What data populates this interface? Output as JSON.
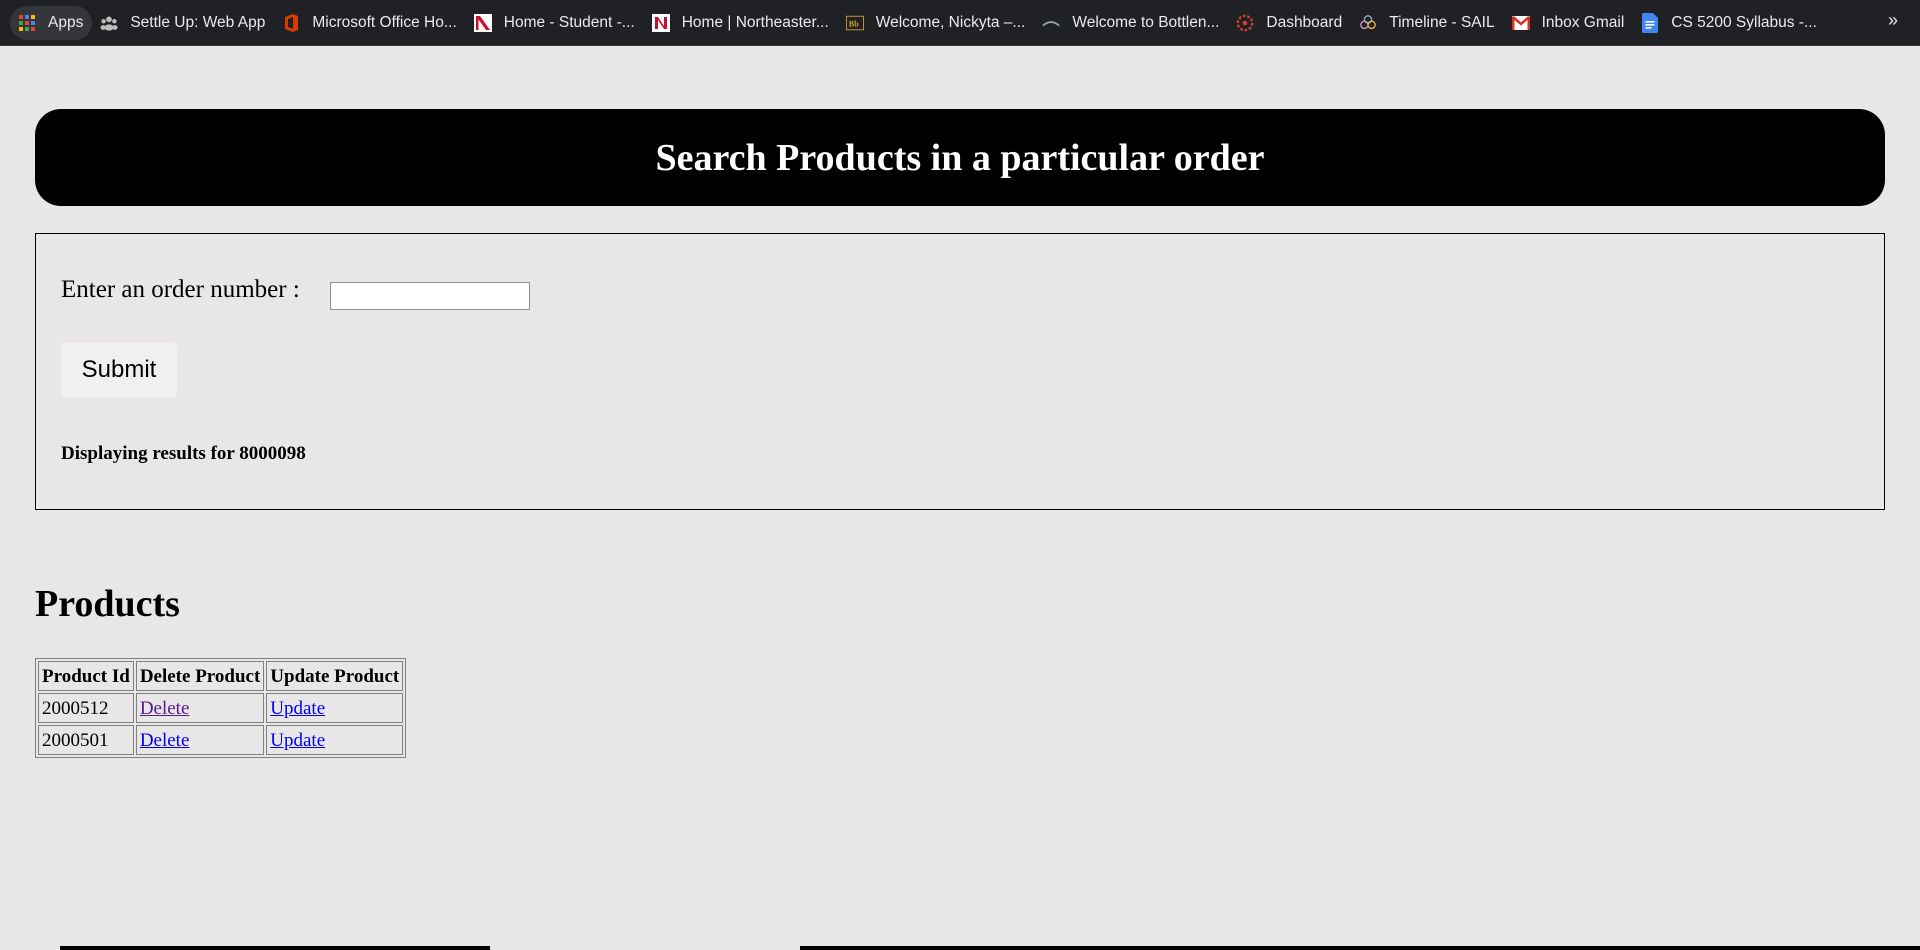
{
  "bookmarks": {
    "apps_label": "Apps",
    "items": [
      {
        "label": "Settle Up: Web App",
        "icon": "people-icon"
      },
      {
        "label": "Microsoft Office Ho...",
        "icon": "office-icon"
      },
      {
        "label": "Home - Student -...",
        "icon": "northeastern-icon"
      },
      {
        "label": "Home | Northeaster...",
        "icon": "northeastern-n-icon"
      },
      {
        "label": "Welcome, Nickyta –...",
        "icon": "blackboard-icon"
      },
      {
        "label": "Welcome to Bottlen...",
        "icon": "bottleneck-icon"
      },
      {
        "label": "Dashboard",
        "icon": "canvas-icon"
      },
      {
        "label": "Timeline - SAIL",
        "icon": "sail-icon"
      },
      {
        "label": "Inbox  Gmail",
        "icon": "gmail-icon"
      },
      {
        "label": "CS 5200 Syllabus -...",
        "icon": "docs-icon"
      }
    ],
    "more": "»"
  },
  "header": {
    "title": "Search Products in a particular order"
  },
  "form": {
    "order_label": "Enter an order number :",
    "order_value": "",
    "submit_label": "Submit",
    "results_text": "Displaying results for 8000098"
  },
  "products": {
    "title": "Products",
    "columns": [
      "Product Id",
      "Delete Product",
      "Update Product"
    ],
    "rows": [
      {
        "id": "2000512",
        "delete": "Delete",
        "update": "Update"
      },
      {
        "id": "2000501",
        "delete": "Delete",
        "update": "Update"
      }
    ]
  },
  "colors": {
    "page_bg": "#e8e6e7",
    "header_bg": "#000000",
    "header_text": "#ffffff",
    "link": "#0000ee",
    "visited_link": "#551a8b",
    "bookmarks_bg": "#202124"
  }
}
